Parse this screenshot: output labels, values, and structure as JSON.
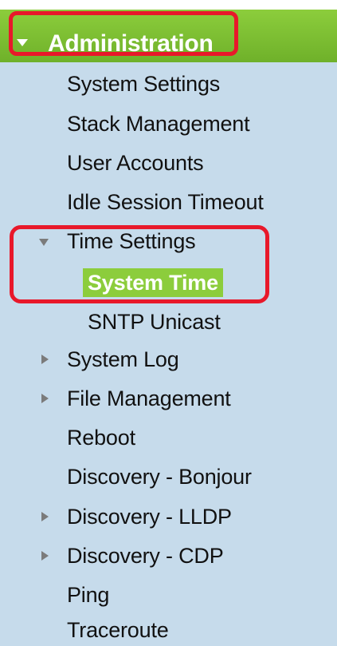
{
  "header": {
    "label": "Administration",
    "expanded": true,
    "color": "#7cbf33"
  },
  "menu": {
    "system_settings": "System Settings",
    "stack_management": "Stack Management",
    "user_accounts": "User Accounts",
    "idle_session_timeout": "Idle Session Timeout",
    "time_settings": "Time Settings",
    "system_time": "System Time",
    "sntp_unicast": "SNTP Unicast",
    "system_log": "System Log",
    "file_management": "File Management",
    "reboot": "Reboot",
    "discovery_bonjour": "Discovery - Bonjour",
    "discovery_lldp": "Discovery - LLDP",
    "discovery_cdp": "Discovery - CDP",
    "ping": "Ping",
    "traceroute": "Traceroute"
  },
  "selected": "System Time",
  "colors": {
    "sidebar_bg": "#c6dbeb",
    "selected_bg": "#8ccd3c",
    "highlight_border": "#e8182a",
    "arrow": "#7b7b7b"
  },
  "icons": {
    "header_toggle": "chevron-down-icon",
    "collapsed": "triangle-right-icon",
    "expanded": "triangle-down-icon"
  }
}
